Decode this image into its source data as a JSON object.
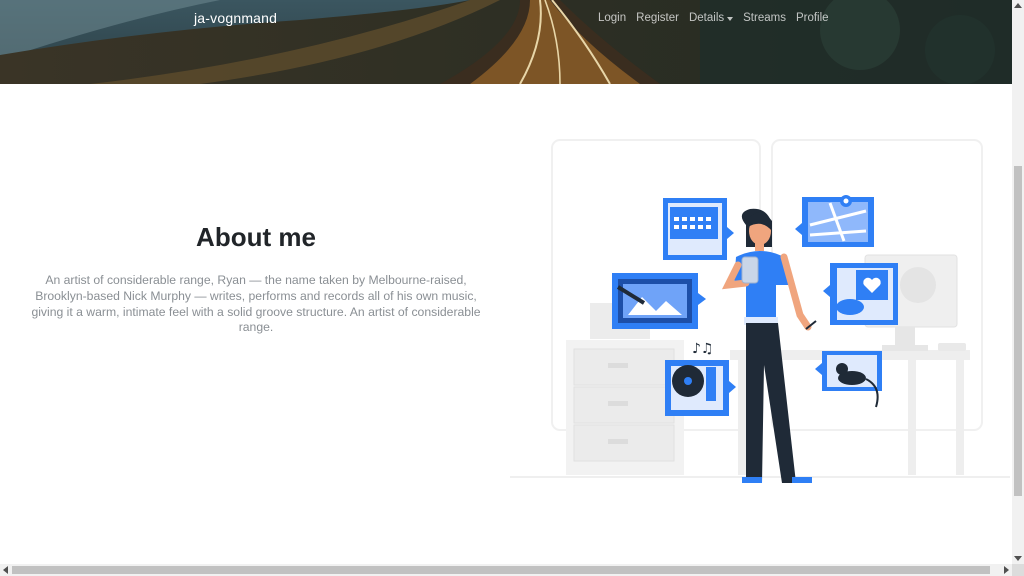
{
  "header": {
    "brand": "ja-vognmand",
    "nav": [
      {
        "label": "Login"
      },
      {
        "label": "Register"
      },
      {
        "label": "Details"
      },
      {
        "label": "Streams"
      },
      {
        "label": "Profile"
      }
    ]
  },
  "about": {
    "title": "About me",
    "text": "An artist of considerable range, Ryan — the name taken by Melbourne-raised, Brooklyn-based Nick Murphy — writes, performs and records all of his own music, giving it a warm, intimate feel with a solid groove structure. An artist of considerable range."
  },
  "colors": {
    "accent": "#2f7ff5",
    "dark": "#1f2a37",
    "text_muted": "#8a8f94"
  }
}
